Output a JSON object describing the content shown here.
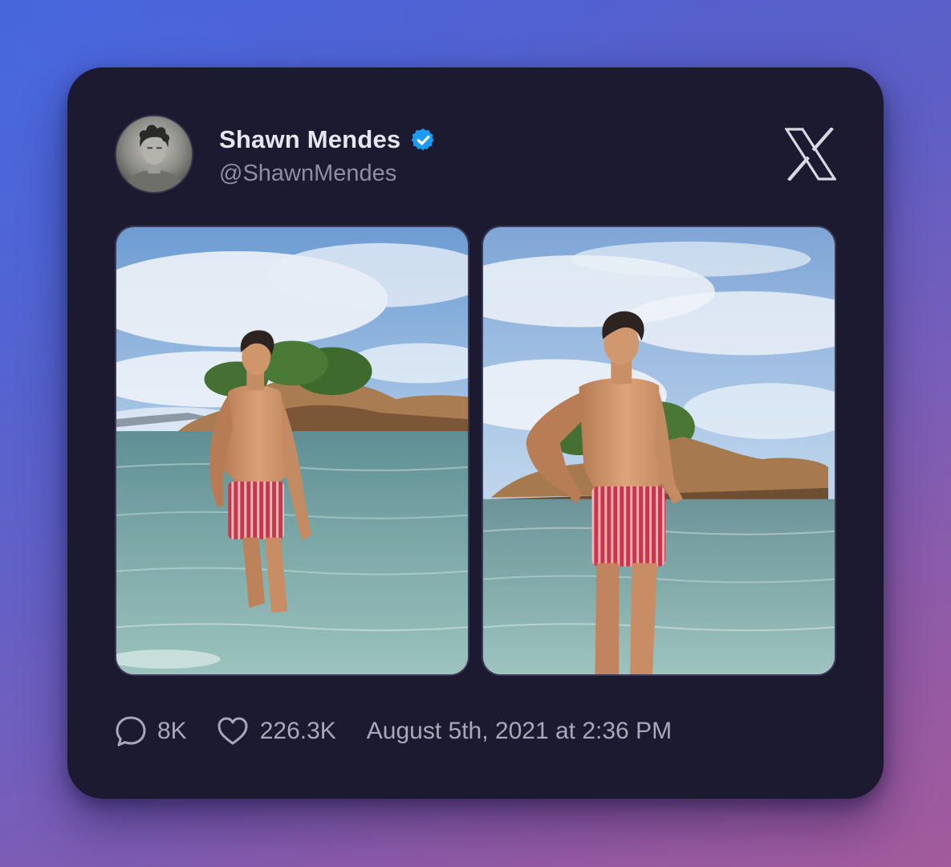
{
  "tweet": {
    "author": {
      "display_name": "Shawn Mendes",
      "handle": "@ShawnMendes",
      "verified": true
    },
    "brand_icon": "x-logo-icon",
    "media": [
      {
        "icon": "photo-beach-1"
      },
      {
        "icon": "photo-beach-2"
      }
    ],
    "stats": {
      "replies": "8K",
      "likes": "226.3K",
      "timestamp": "August 5th, 2021 at 2:36 PM"
    }
  },
  "colors": {
    "card_background": "#1c1a30",
    "verified_badge": "#1d9bf0",
    "name_text": "#e6e6ee",
    "secondary_text": "#8f8da3"
  }
}
